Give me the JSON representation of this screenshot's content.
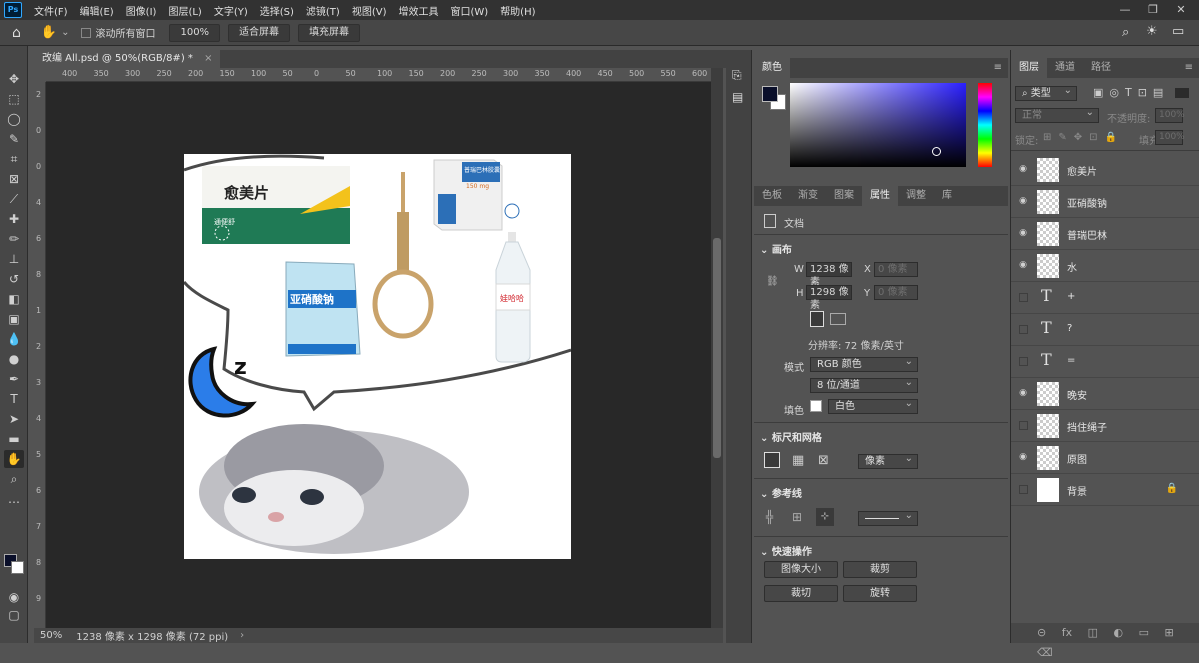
{
  "menubar": {
    "logo": "Ps",
    "items": [
      "文件(F)",
      "编辑(E)",
      "图像(I)",
      "图层(L)",
      "文字(Y)",
      "选择(S)",
      "滤镜(T)",
      "视图(V)",
      "增效工具",
      "窗口(W)",
      "帮助(H)"
    ]
  },
  "optionsbar": {
    "scroll_all": "滚动所有窗口",
    "zoom_value": "100%",
    "fit_screen": "适合屏幕",
    "fill_screen": "填充屏幕"
  },
  "document": {
    "tab_title": "改编 All.psd @ 50%(RGB/8#) *",
    "close_glyph": "×",
    "ruler_h_labels": [
      "400",
      "350",
      "300",
      "250",
      "200",
      "150",
      "100",
      "50",
      "0",
      "50",
      "100",
      "150",
      "200",
      "250",
      "300",
      "350",
      "400",
      "450",
      "500",
      "550",
      "600",
      "650",
      "700",
      "750",
      "800",
      "850",
      "900",
      "950",
      "1000",
      "1050",
      "1100",
      "1150",
      "1200",
      "1250",
      "1300",
      "1350",
      "1400",
      "1450",
      "1500",
      "1550",
      "1600",
      "1650"
    ],
    "ruler_v_labels": [
      "2",
      "0",
      "0",
      "4",
      "6",
      "8",
      "1",
      "2",
      "3",
      "4",
      "5",
      "6",
      "7",
      "8",
      "9"
    ]
  },
  "artwork": {
    "box_medicine_name": "愈美片",
    "box_medicine_sub": "通便舒",
    "bag_label": "亚硝酸钠",
    "bag_maker": "",
    "pill_box_name": "普瑞巴林胶囊",
    "pill_box_dose": "150 mg",
    "bottle_brand": "娃哈哈",
    "sleep_glyph": "z"
  },
  "statusbar": {
    "zoom": "50%",
    "info": "1238 像素 x 1298 像素 (72 ppi)"
  },
  "color_panel": {
    "tab": "颜色"
  },
  "props_tabs": [
    "色板",
    "渐变",
    "图案",
    "属性",
    "调整",
    "库"
  ],
  "properties": {
    "doc_label": "文档",
    "canvas_title": "画布",
    "w_label": "W",
    "w_value": "1238 像素",
    "x_label": "X",
    "x_placeholder": "0 像素",
    "h_label": "H",
    "h_value": "1298 像素",
    "y_label": "Y",
    "y_placeholder": "0 像素",
    "resolution": "分辨率: 72 像素/英寸",
    "mode_label": "模式",
    "mode_value": "RGB 颜色",
    "depth_value": "8 位/通道",
    "fill_label": "填色",
    "fill_value": "白色",
    "rulers_title": "标尺和网格",
    "ruler_unit": "像素",
    "guides_title": "参考线",
    "quick_title": "快速操作",
    "btn_image_size": "图像大小",
    "btn_crop": "裁剪",
    "btn_trim": "裁切",
    "btn_rotate": "旋转"
  },
  "layers_panel": {
    "tabs": [
      "图层",
      "通道",
      "路径"
    ],
    "filter_kind": "类型",
    "blend_mode": "正常",
    "opacity_label": "不透明度:",
    "opacity_value": "100%",
    "lock_label": "锁定:",
    "fill_label": "填充:",
    "fill_value": "100%",
    "layers": [
      {
        "name": "愈美片",
        "visible": true,
        "kind": "image"
      },
      {
        "name": "亚硝酸钠",
        "visible": true,
        "kind": "image"
      },
      {
        "name": "普瑞巴林",
        "visible": true,
        "kind": "image"
      },
      {
        "name": "水",
        "visible": true,
        "kind": "image"
      },
      {
        "name": "+",
        "visible": false,
        "kind": "text"
      },
      {
        "name": "?",
        "visible": false,
        "kind": "text"
      },
      {
        "name": "=",
        "visible": false,
        "kind": "text"
      },
      {
        "name": "晚安",
        "visible": true,
        "kind": "image"
      },
      {
        "name": "挡住绳子",
        "visible": false,
        "kind": "image"
      },
      {
        "name": "原图",
        "visible": true,
        "kind": "image"
      },
      {
        "name": "背景",
        "visible": false,
        "kind": "background"
      }
    ]
  },
  "colors": {
    "foreground": "#0a0f2a",
    "background": "#ffffff",
    "accent_blue": "#31a8ff"
  }
}
